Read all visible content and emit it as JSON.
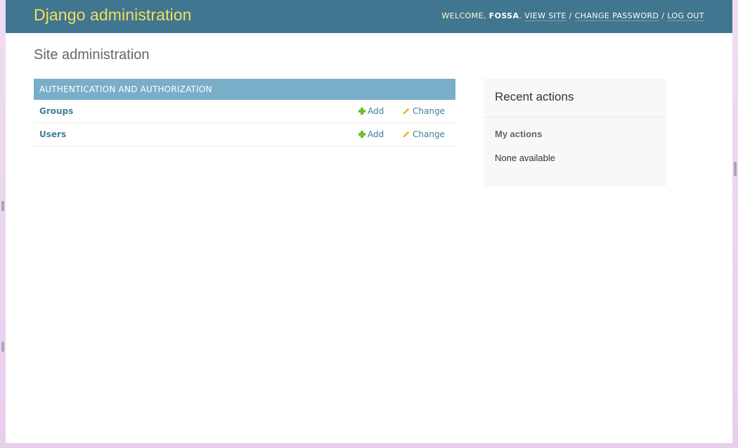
{
  "header": {
    "branding": "Django administration",
    "welcome_prefix": "WELCOME, ",
    "username": "FOSSA",
    "welcome_suffix": ". ",
    "view_site": "VIEW SITE",
    "sep1": " / ",
    "change_password": "CHANGE PASSWORD",
    "sep2": " / ",
    "log_out": "LOG OUT"
  },
  "page": {
    "title": "Site administration"
  },
  "module": {
    "caption": "AUTHENTICATION AND AUTHORIZATION",
    "models": [
      {
        "name": "Groups",
        "add": "Add",
        "change": "Change"
      },
      {
        "name": "Users",
        "add": "Add",
        "change": "Change"
      }
    ]
  },
  "recent": {
    "title": "Recent actions",
    "subtitle": "My actions",
    "empty": "None available"
  },
  "colors": {
    "header_bg": "#417690",
    "branding": "#f5dd5d",
    "module_caption_bg": "#79aec8",
    "link": "#447e9b",
    "add_icon": "#70bf2b",
    "change_icon": "#efb80b"
  }
}
